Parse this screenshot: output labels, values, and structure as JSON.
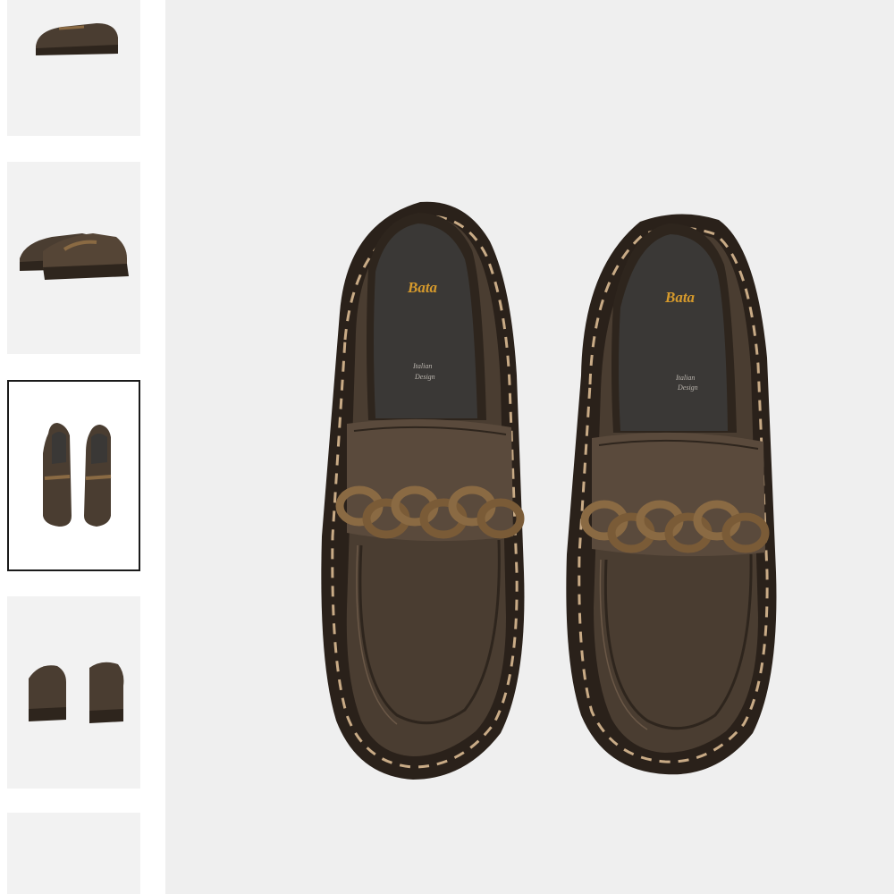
{
  "gallery": {
    "selected_index": 2,
    "thumbnails": [
      {
        "view": "side-single"
      },
      {
        "view": "pair-angled"
      },
      {
        "view": "top-pair"
      },
      {
        "view": "back-pair"
      },
      {
        "view": "empty"
      }
    ]
  },
  "product": {
    "brand_label": "Bata",
    "insole_tagline_line1": "Italian",
    "insole_tagline_line2": "Design"
  },
  "colors": {
    "leather": "#4a3d31",
    "leather_dark": "#2e251d",
    "leather_light": "#5e4e40",
    "stitch": "#c9ab86",
    "chain": "#8a6a43",
    "insole": "#3a3836",
    "brand_gold": "#d69a2c"
  }
}
